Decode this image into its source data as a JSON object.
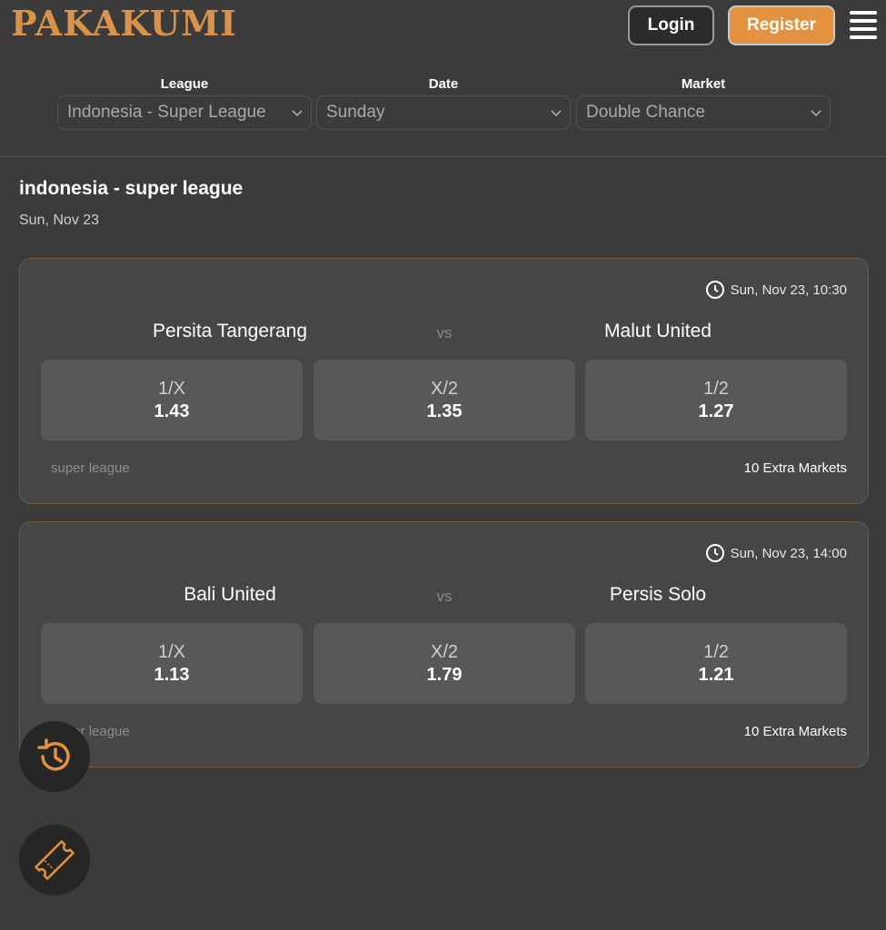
{
  "brand": {
    "logo_text": "PAKAKUMI",
    "accent": "#e4923f"
  },
  "header": {
    "login_label": "Login",
    "register_label": "Register",
    "menu_icon": "hamburger-icon"
  },
  "filters": [
    {
      "label": "League",
      "value": "Indonesia - Super League"
    },
    {
      "label": "Date",
      "value": "Sunday"
    },
    {
      "label": "Market",
      "value": "Double Chance"
    }
  ],
  "section": {
    "title": "indonesia - super league",
    "date": "Sun, Nov 23"
  },
  "matches": [
    {
      "datetime": "Sun, Nov 23, 10:30",
      "home": "Persita Tangerang",
      "vs": "vs",
      "away": "Malut United",
      "odds": [
        {
          "label": "1/X",
          "value": "1.43"
        },
        {
          "label": "X/2",
          "value": "1.35"
        },
        {
          "label": "1/2",
          "value": "1.27"
        }
      ],
      "league": "super league",
      "extra": "10 Extra Markets"
    },
    {
      "datetime": "Sun, Nov 23, 14:00",
      "home": "Bali United",
      "vs": "vs",
      "away": "Persis Solo",
      "odds": [
        {
          "label": "1/X",
          "value": "1.13"
        },
        {
          "label": "X/2",
          "value": "1.79"
        },
        {
          "label": "1/2",
          "value": "1.21"
        }
      ],
      "league": "super league",
      "extra": "10 Extra Markets"
    }
  ],
  "floating": {
    "history_icon": "history-icon",
    "betslip_icon": "ticket-icon"
  }
}
